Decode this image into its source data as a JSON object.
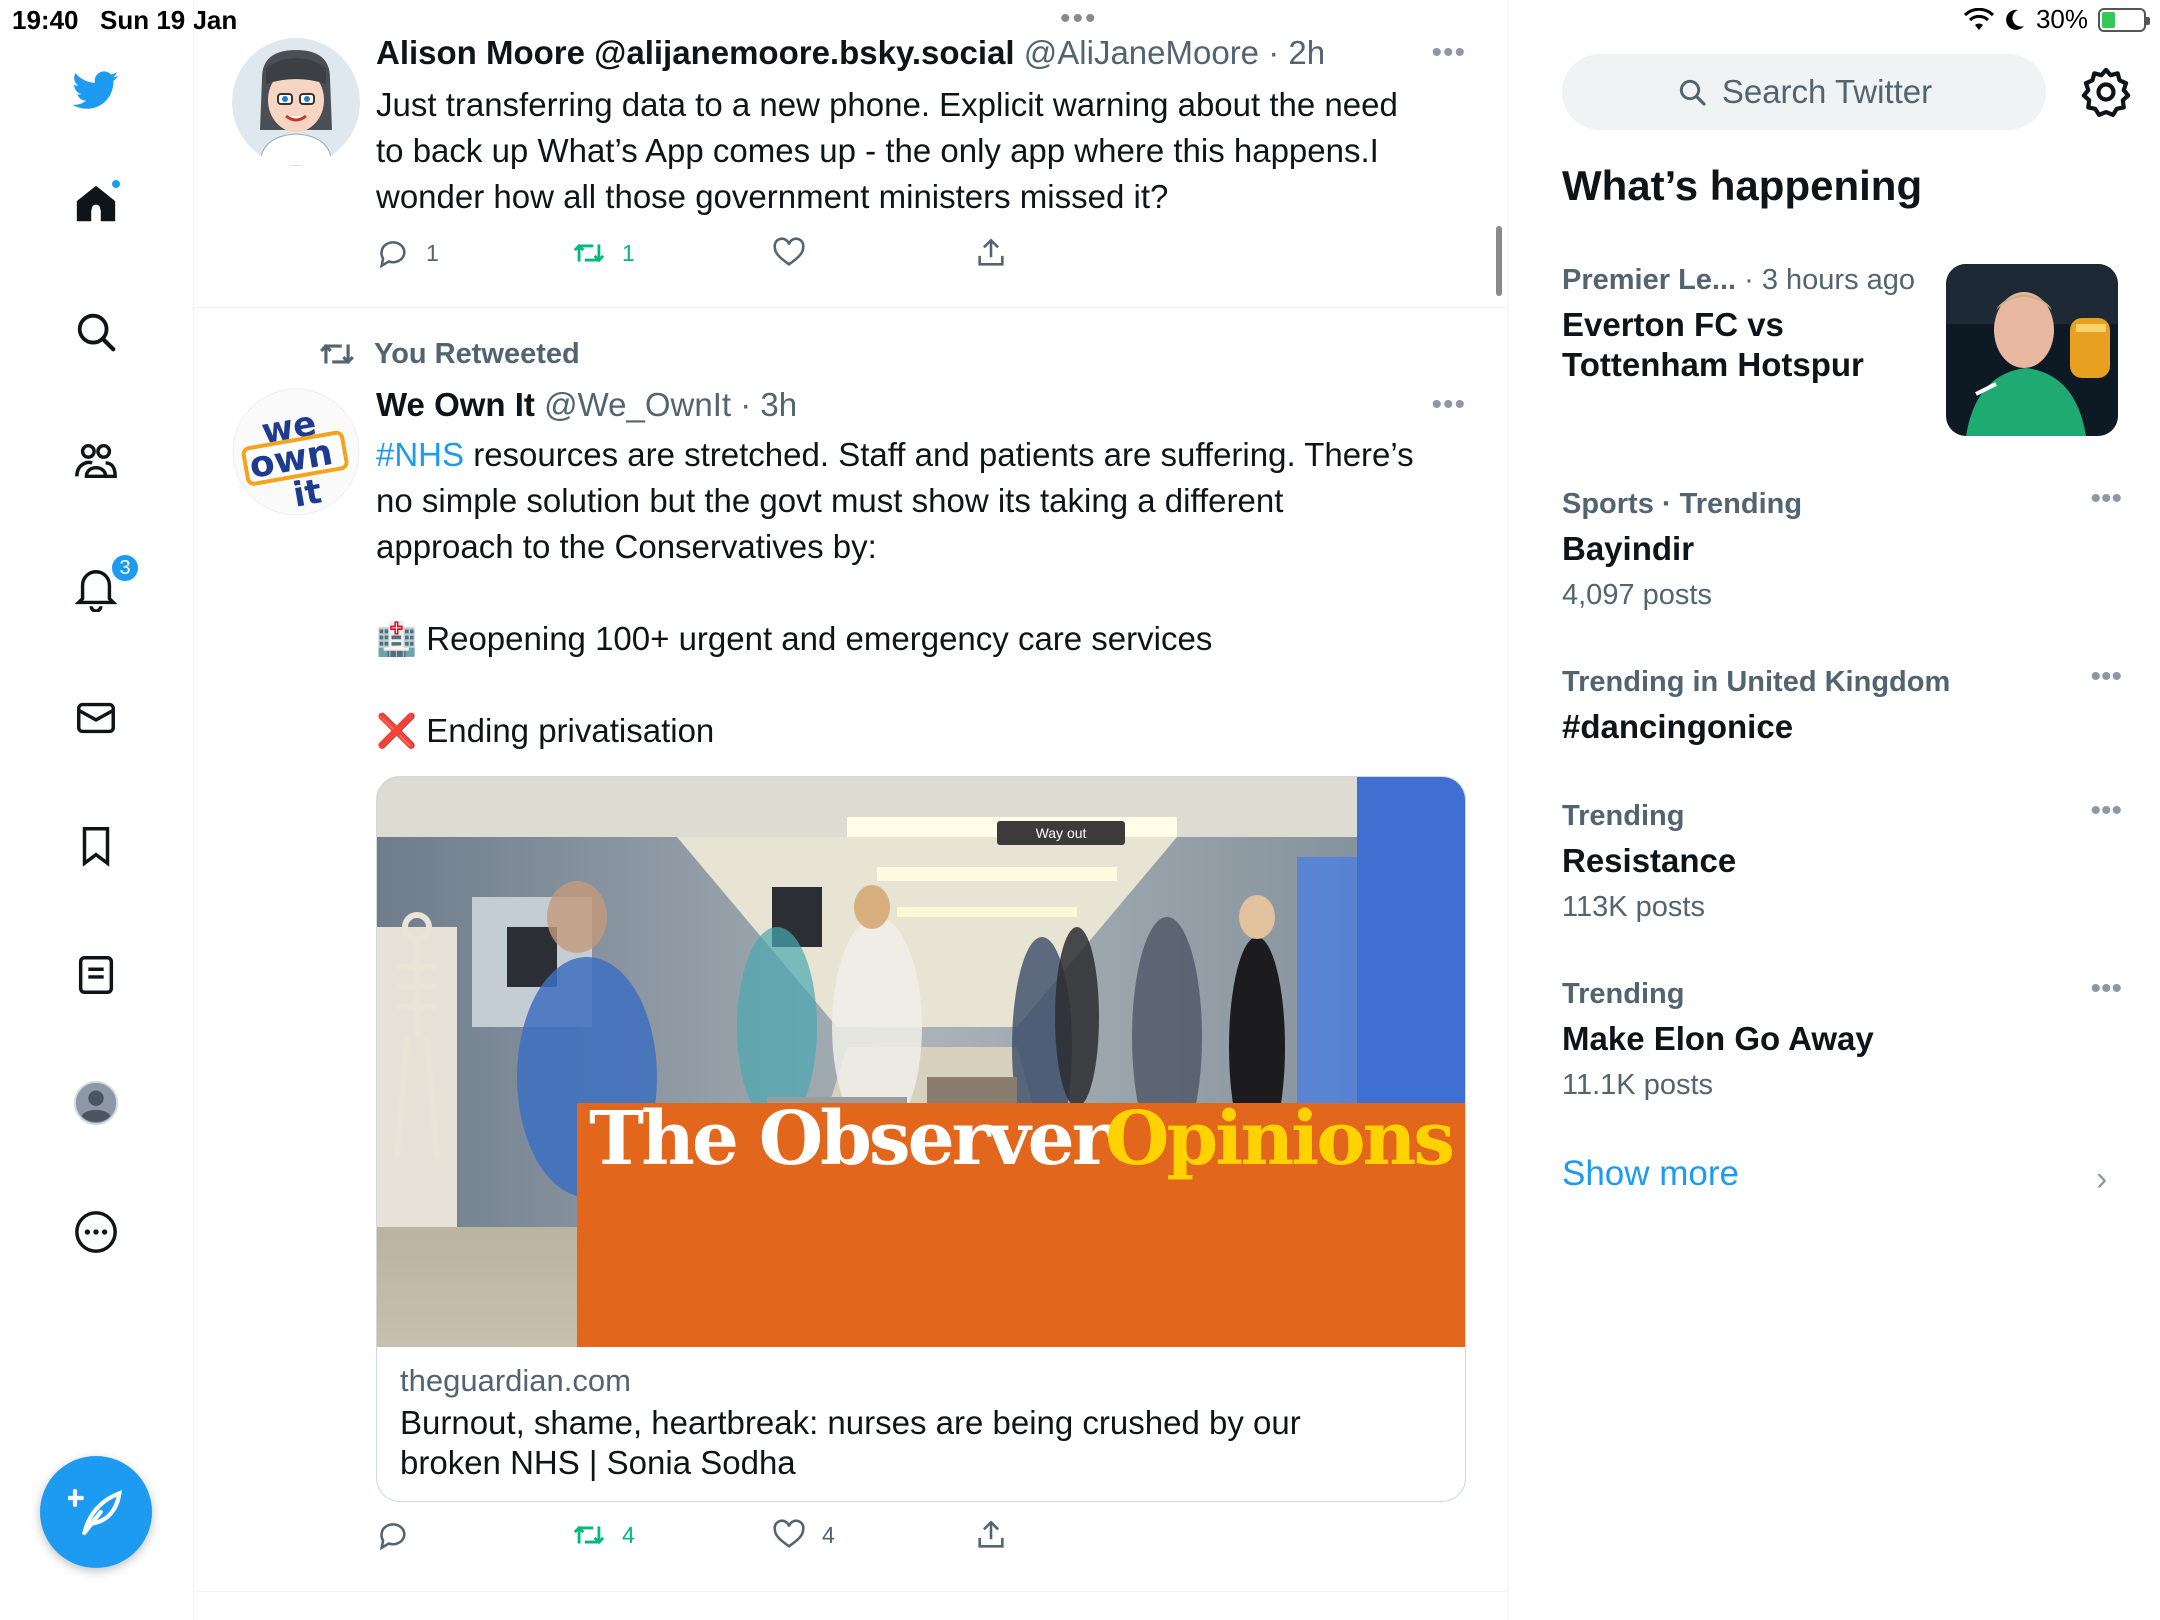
{
  "status_bar": {
    "time": "19:40",
    "date": "Sun 19 Jan",
    "battery": "30%",
    "multitask_dots": "•••"
  },
  "nav": {
    "notifications_badge": "3",
    "icons": [
      "twitter-logo-icon",
      "home-icon",
      "explore-search-icon",
      "communities-icon",
      "notifications-bell-icon",
      "messages-mail-icon",
      "bookmarks-icon",
      "lists-icon",
      "profile-avatar-icon",
      "more-circle-icon",
      "compose-tweet-icon"
    ]
  },
  "tweets": [
    {
      "name": "Alison Moore @alijanemoore.bsky.social",
      "handle": "@AliJaneMoore",
      "time": "· 2h",
      "lines": [
        "Just transferring data to a new phone. Explicit warning about the need",
        "to back up What’s App comes up - the only app where this happens.I",
        "wonder how all those government ministers missed it?"
      ],
      "replies": "1",
      "retweets": "1",
      "likes": ""
    },
    {
      "retweeted_label": "You Retweeted",
      "name": "We Own It",
      "handle": "@We_OwnIt",
      "time": "· 3h",
      "hashtag": "#NHS",
      "line1_rest": " resources are stretched. Staff and patients are suffering. There’s",
      "line2": "no simple solution but the govt must show its taking a different",
      "line3": "approach to the Conservatives by:",
      "bullet1_emoji": "🏥",
      "bullet1": "Reopening 100+ urgent and emergency care services",
      "bullet2_emoji": "❌",
      "bullet2": "Ending privatisation",
      "card": {
        "banner_observer": "The Observer",
        "banner_opinions": "Opinions",
        "sign": "Way out",
        "domain": "theguardian.com",
        "title_line1": "Burnout, shame, heartbreak: nurses are being crushed by our",
        "title_line2": "broken NHS | Sonia Sodha"
      },
      "replies": "",
      "retweets": "4",
      "likes": "4"
    }
  ],
  "sidebar": {
    "search_placeholder": "Search Twitter",
    "whats_happening": "What’s happening",
    "trends": [
      {
        "category": "Premier Le...",
        "when": " · 3 hours ago",
        "topic_line1": "Everton FC vs",
        "topic_line2": "Tottenham Hotspur"
      },
      {
        "category": "Sports · Trending",
        "topic": "Bayindir",
        "count": "4,097 posts"
      },
      {
        "category": "Trending in United Kingdom",
        "topic": "#dancingonice"
      },
      {
        "category": "Trending",
        "topic": "Resistance",
        "count": "113K posts"
      },
      {
        "category": "Trending",
        "topic": "Make Elon Go Away",
        "count": "11.1K posts"
      }
    ],
    "show_more": "Show more"
  },
  "colors": {
    "accent": "#1d9bf0",
    "retweet_green": "#00ba7c",
    "secondary_text": "#536471",
    "observer_orange": "#e2661b",
    "opinions_yellow": "#ffd200"
  }
}
